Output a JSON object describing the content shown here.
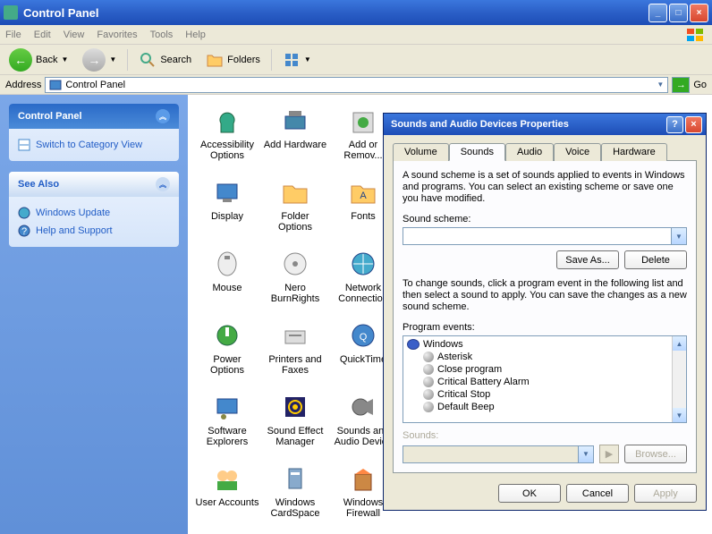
{
  "window": {
    "title": "Control Panel",
    "menus": [
      "File",
      "Edit",
      "View",
      "Favorites",
      "Tools",
      "Help"
    ],
    "toolbar": {
      "back": "Back",
      "search": "Search",
      "folders": "Folders"
    },
    "address_label": "Address",
    "address_value": "Control Panel",
    "go": "Go"
  },
  "sidebar": {
    "box1": {
      "title": "Control Panel",
      "link": "Switch to Category View"
    },
    "box2": {
      "title": "See Also",
      "links": [
        "Windows Update",
        "Help and Support"
      ]
    }
  },
  "icons": [
    "Accessibility Options",
    "Add Hardware",
    "Add or Remov...",
    "Display",
    "Folder Options",
    "Fonts",
    "Mouse",
    "Nero BurnRights",
    "Network Connection",
    "Power Options",
    "Printers and Faxes",
    "QuickTime",
    "Software Explorers",
    "Sound Effect Manager",
    "Sounds and Audio Device",
    "User Accounts",
    "Windows CardSpace",
    "Windows Firewall"
  ],
  "dialog": {
    "title": "Sounds and Audio Devices Properties",
    "tabs": [
      "Volume",
      "Sounds",
      "Audio",
      "Voice",
      "Hardware"
    ],
    "active_tab": 1,
    "desc1": "A sound scheme is a set of sounds applied to events in Windows and programs. You can select an existing scheme or save one you have modified.",
    "scheme_label": "Sound scheme:",
    "scheme_value": "",
    "save_as": "Save As...",
    "delete": "Delete",
    "desc2": "To change sounds, click a program event in the following list and then select a sound to apply. You can save the changes as a new sound scheme.",
    "events_label": "Program events:",
    "events": [
      "Windows",
      "Asterisk",
      "Close program",
      "Critical Battery Alarm",
      "Critical Stop",
      "Default Beep"
    ],
    "sounds_label": "Sounds:",
    "browse": "Browse...",
    "ok": "OK",
    "cancel": "Cancel",
    "apply": "Apply"
  }
}
